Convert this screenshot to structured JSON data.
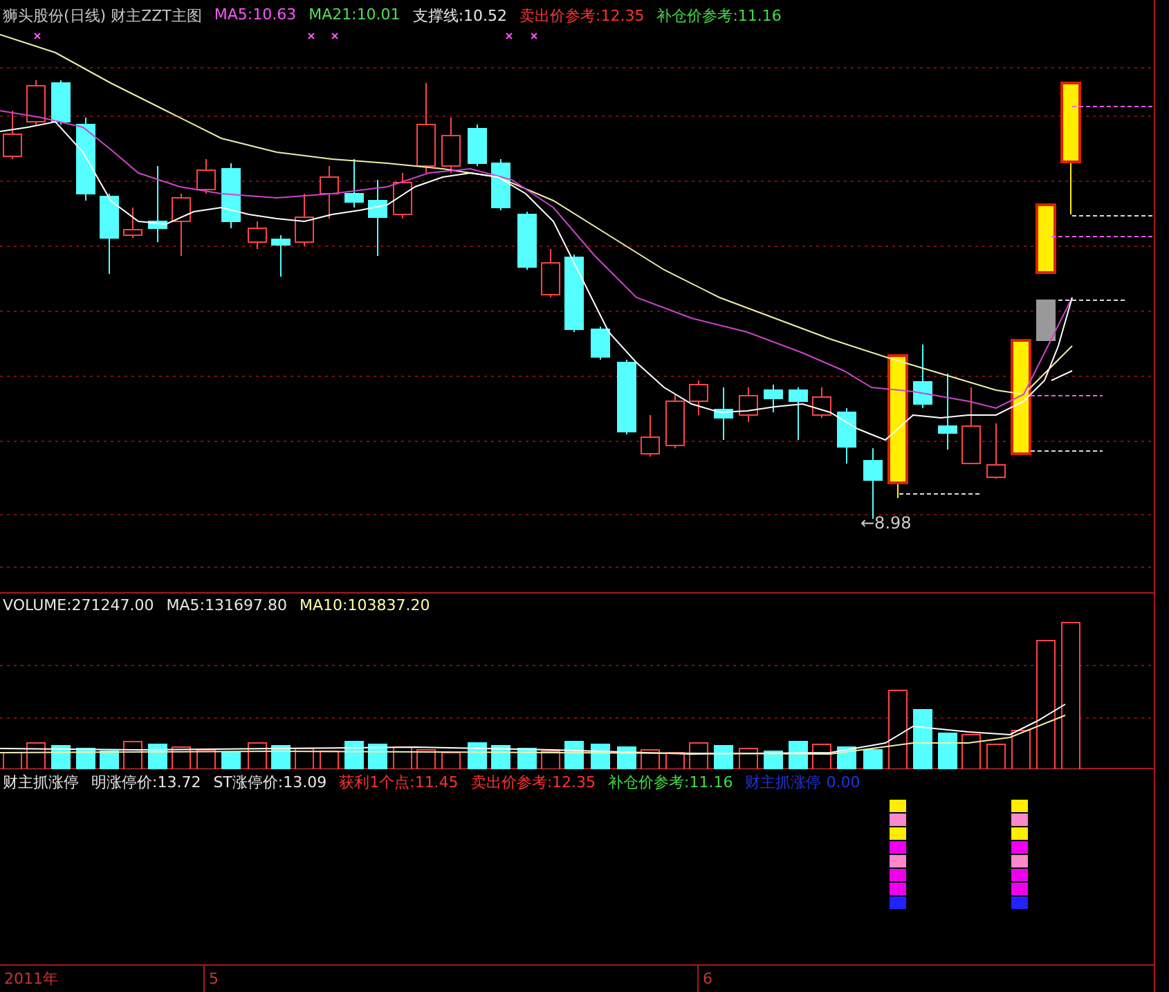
{
  "main_chart": {
    "legend": [
      {
        "text": "狮头股份(日线) 财主ZZT主图",
        "color": "#c8c8c8"
      },
      {
        "text": "MA5:10.63",
        "color": "#ff55ff"
      },
      {
        "text": "MA21:10.01",
        "color": "#55dd55"
      },
      {
        "text": "支撑线:10.52",
        "color": "#e8e8e8"
      },
      {
        "text": "卖出价参考:12.35",
        "color": "#ff3333"
      },
      {
        "text": "补仓价参考:11.16",
        "color": "#44dd44"
      }
    ],
    "price_label": "←8.98"
  },
  "volume_chart": {
    "legend": [
      {
        "text": "VOLUME:271247.00",
        "color": "#e8e8e8"
      },
      {
        "text": "MA5:131697.80",
        "color": "#e8e8e8"
      },
      {
        "text": "MA10:103837.20",
        "color": "#ffffaa"
      }
    ]
  },
  "indicator_chart": {
    "legend": [
      {
        "text": "财主抓涨停",
        "color": "#e8e8e8"
      },
      {
        "text": "明涨停价:13.72",
        "color": "#e8e8e8"
      },
      {
        "text": "ST涨停价:13.09",
        "color": "#e8e8e8"
      },
      {
        "text": "获利1个点:11.45",
        "color": "#ff3333"
      },
      {
        "text": "卖出价参考:12.35",
        "color": "#ff3333"
      },
      {
        "text": "补仓价参考:11.16",
        "color": "#44dd44"
      },
      {
        "text": "财主抓涨停 0.00",
        "color": "#2233dd"
      }
    ]
  },
  "time_axis": {
    "labels": [
      "2011年",
      "5",
      "6"
    ]
  }
}
